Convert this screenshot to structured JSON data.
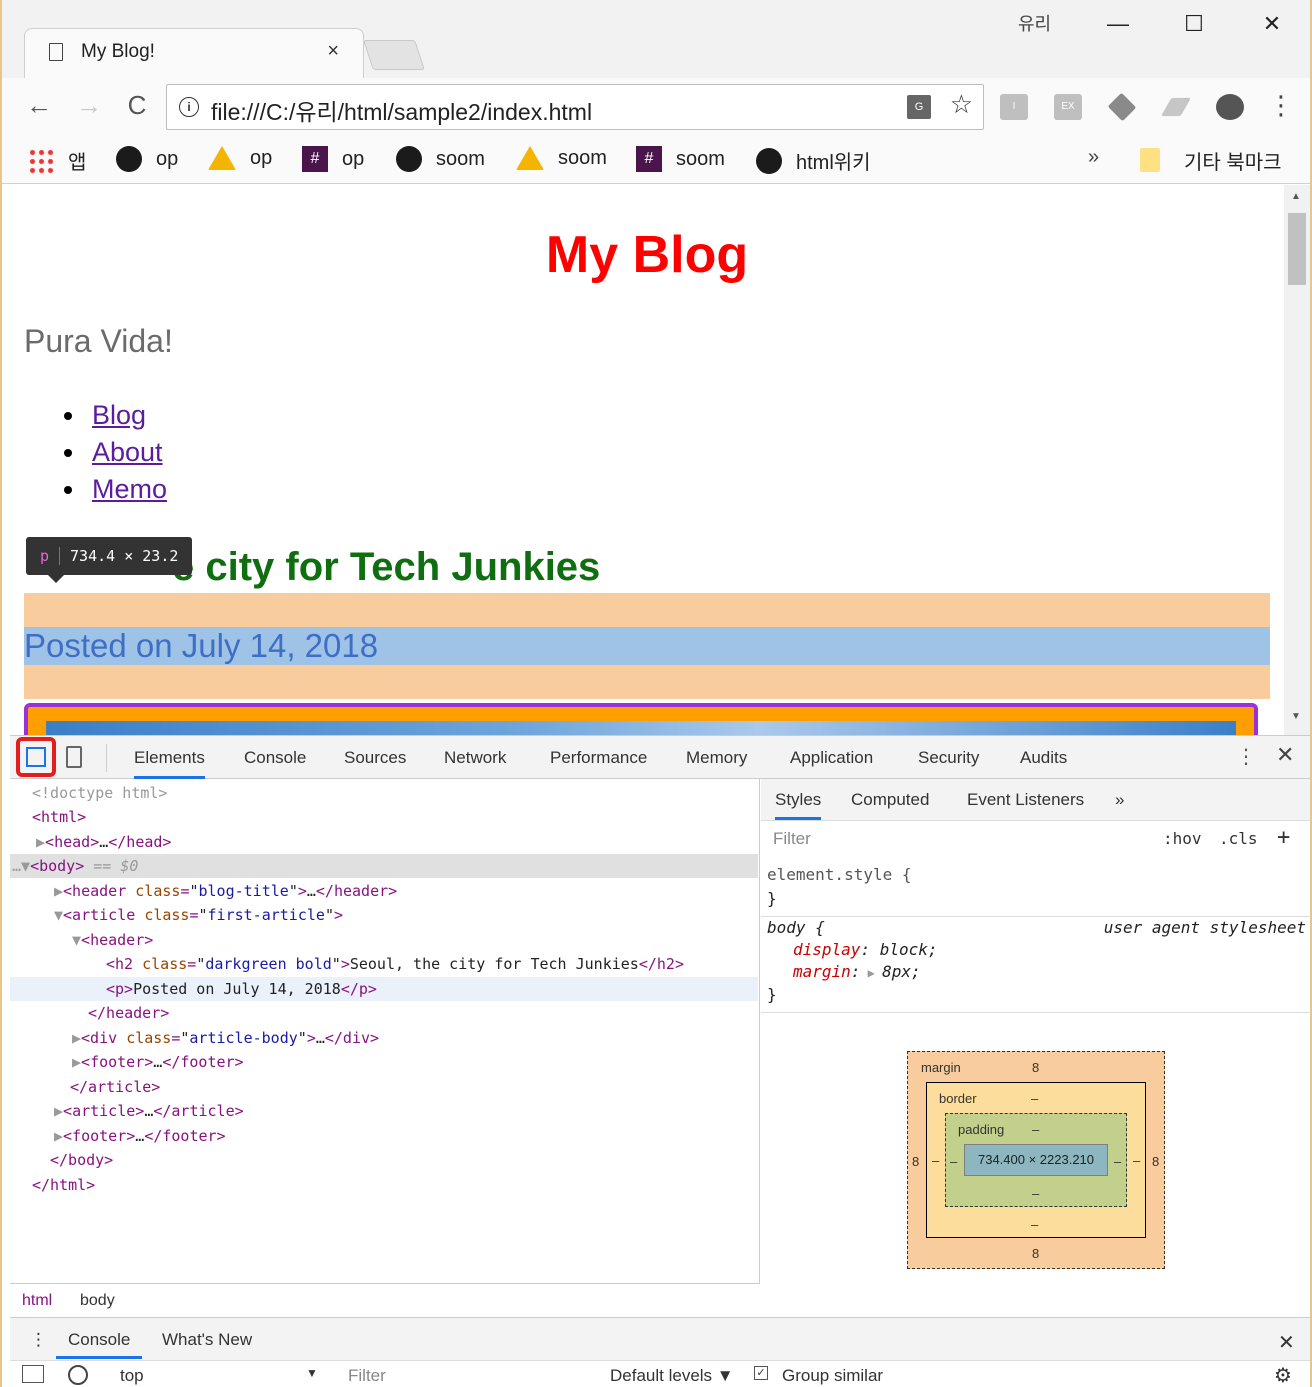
{
  "window": {
    "tab_title": "My Blog!",
    "tab_close": "×",
    "user_name": "유리",
    "minimize": "—",
    "maximize": "☐",
    "close": "✕"
  },
  "toolbar": {
    "back": "←",
    "forward": "→",
    "reload": "C",
    "url": "file:///C:/유리/html/sample2/index.html",
    "translate": "G",
    "star": "☆",
    "ext_i": "I",
    "ext_ex": "EX",
    "menu": "⋮"
  },
  "bookmarks": {
    "items": [
      {
        "label": "앱",
        "icon": "apps-icon"
      },
      {
        "label": "op",
        "icon": "github-icon"
      },
      {
        "label": "op",
        "icon": "drive-icon"
      },
      {
        "label": "op",
        "icon": "slack-icon"
      },
      {
        "label": "soom",
        "icon": "github-icon"
      },
      {
        "label": "soom",
        "icon": "drive-icon"
      },
      {
        "label": "soom",
        "icon": "slack-icon"
      },
      {
        "label": "html위키",
        "icon": "github-icon"
      }
    ],
    "more": "»",
    "other": "기타 북마크"
  },
  "page": {
    "title": "My Blog",
    "tagline": "Pura Vida!",
    "nav": [
      "Blog",
      "About",
      "Memo"
    ],
    "article_title_visible": "e city for Tech Junkies",
    "posted": "Posted on July 14, 2018",
    "tooltip_tag": "p",
    "tooltip_size": "734.4 × 23.2"
  },
  "devtools": {
    "tabs": [
      "Elements",
      "Console",
      "Sources",
      "Network",
      "Performance",
      "Memory",
      "Application",
      "Security",
      "Audits"
    ],
    "kebab": "⋮",
    "close": "✕",
    "dom": {
      "doctype": "<!doctype html>",
      "html_open": "<html>",
      "head": "head",
      "body": "body",
      "body_suffix": "== $0",
      "header_attr": "blog-title",
      "article_attr": "first-article",
      "header2": "header",
      "h2_attr": "darkgreen bold",
      "h2_text": "Seoul, the city for Tech Junkies",
      "p_text": "Posted on July 14, 2018",
      "div_attr": "article-body",
      "footer": "footer",
      "article": "article",
      "html_close": "</html>"
    },
    "breadcrumbs": [
      "html",
      "body"
    ],
    "styles": {
      "tabs": [
        "Styles",
        "Computed",
        "Event Listeners",
        "»"
      ],
      "filter_placeholder": "Filter",
      "hov": ":hov",
      "cls": ".cls",
      "plus": "+",
      "element_style": "element.style {",
      "close_brace": "}",
      "body_selector": "body {",
      "user_agent": "user agent stylesheet",
      "prop1": "display",
      "val1": "block;",
      "prop2": "margin",
      "val2": "8px;"
    },
    "box_model": {
      "margin_label": "margin",
      "border_label": "border",
      "padding_label": "padding",
      "margin_top": "8",
      "margin_bottom": "8",
      "margin_left": "8",
      "margin_right": "8",
      "dash": "–",
      "content": "734.400 × 2223.210"
    },
    "drawer": {
      "tabs": [
        "Console",
        "What's New"
      ],
      "context": "top",
      "filter_placeholder": "Filter",
      "levels": "Default levels ▼",
      "group_similar": "Group similar"
    }
  },
  "colors": {
    "blog_title": "#ff0000",
    "article_title": "#0f6e0f",
    "margin_highlight": "#f9cc9d",
    "content_highlight": "#9fc2e7",
    "inspect_outline": "#e21d1d"
  }
}
